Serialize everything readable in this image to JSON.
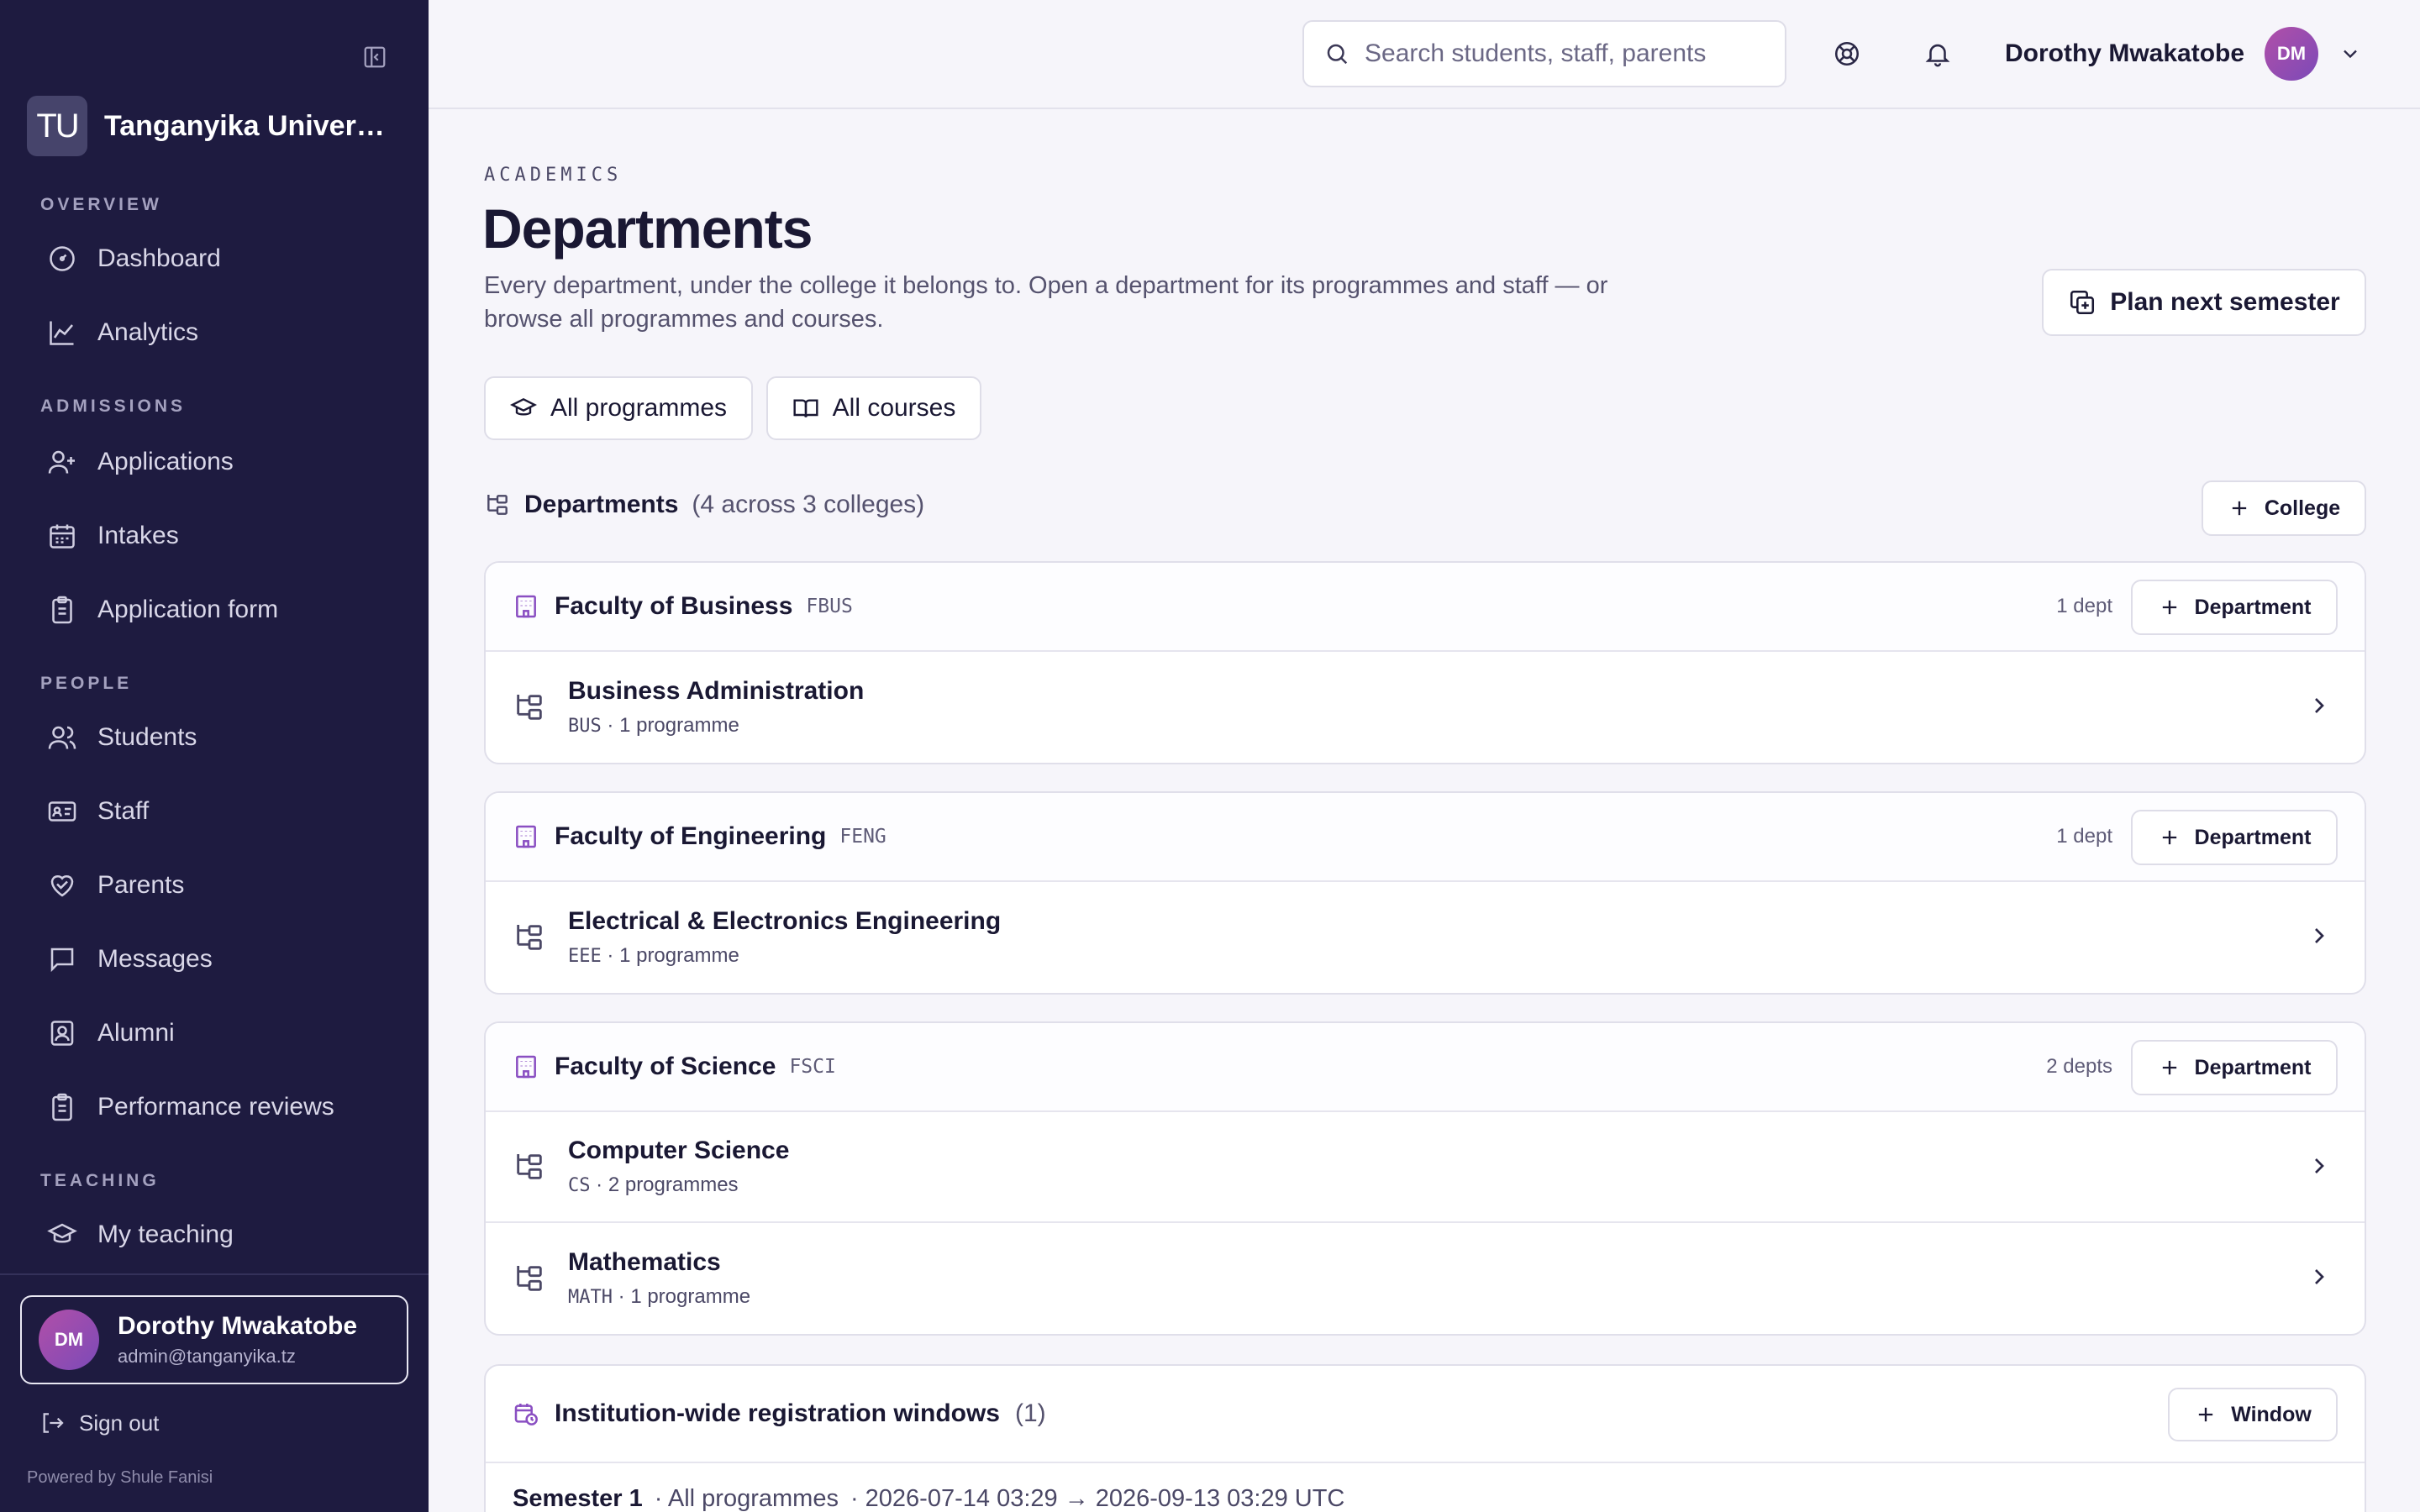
{
  "sidebar": {
    "brand_initials": "TU",
    "brand_name": "Tanganyika University",
    "sections": {
      "overview": "OVERVIEW",
      "admissions": "ADMISSIONS",
      "people": "PEOPLE",
      "teaching": "TEACHING"
    },
    "items": {
      "dashboard": "Dashboard",
      "analytics": "Analytics",
      "applications": "Applications",
      "intakes": "Intakes",
      "application_form": "Application form",
      "students": "Students",
      "staff": "Staff",
      "parents": "Parents",
      "messages": "Messages",
      "alumni": "Alumni",
      "performance_reviews": "Performance reviews",
      "my_teaching": "My teaching"
    },
    "user": {
      "initials": "DM",
      "name": "Dorothy Mwakatobe",
      "email": "admin@tanganyika.tz"
    },
    "sign_out": "Sign out",
    "powered_by": "Powered by Shule Fanisi"
  },
  "header": {
    "search_placeholder": "Search students, staff, parents",
    "user_name": "Dorothy Mwakatobe",
    "user_initials": "DM"
  },
  "page": {
    "eyebrow": "ACADEMICS",
    "title": "Departments",
    "description": "Every department, under the college it belongs to. Open a department for its programmes and staff — or browse all programmes and courses.",
    "plan_button": "Plan next semester",
    "all_programmes": "All programmes",
    "all_courses": "All courses",
    "section_title": "Departments",
    "section_sub": "(4 across 3 colleges)",
    "college_button": "College",
    "department_button": "Department"
  },
  "colleges": [
    {
      "name": "Faculty of Business",
      "code": "FBUS",
      "count": "1 dept",
      "departments": [
        {
          "name": "Business Administration",
          "code": "BUS",
          "programmes": "1 programme"
        }
      ]
    },
    {
      "name": "Faculty of Engineering",
      "code": "FENG",
      "count": "1 dept",
      "departments": [
        {
          "name": "Electrical & Electronics Engineering",
          "code": "EEE",
          "programmes": "1 programme"
        }
      ]
    },
    {
      "name": "Faculty of Science",
      "code": "FSCI",
      "count": "2 depts",
      "departments": [
        {
          "name": "Computer Science",
          "code": "CS",
          "programmes": "2 programmes"
        },
        {
          "name": "Mathematics",
          "code": "MATH",
          "programmes": "1 programme"
        }
      ]
    }
  ],
  "windows": {
    "title": "Institution-wide registration windows",
    "count": "(1)",
    "button": "Window",
    "rows": [
      {
        "semester": "Semester 1",
        "scope": "· All programmes",
        "range": "·  2026-07-14 03:29 → 2026-09-13 03:29 UTC"
      }
    ]
  },
  "colors": {
    "sidebar_bg": "#1e1b40",
    "accent_purple": "#7c4ab8"
  }
}
